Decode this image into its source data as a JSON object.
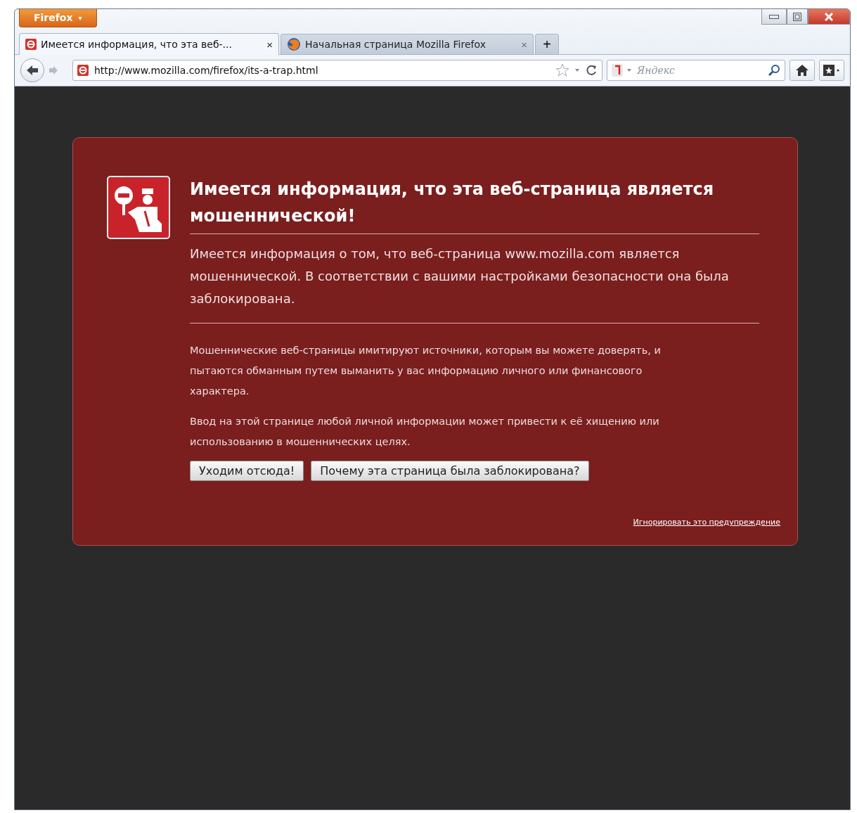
{
  "app_button": {
    "label": "Firefox",
    "caret": "▾"
  },
  "tabs": [
    {
      "label": "Имеется информация, что эта веб-...",
      "close": "×",
      "selected": true,
      "kind": "blocked"
    },
    {
      "label": "Начальная страница Mozilla Firefox",
      "close": "×",
      "selected": false,
      "kind": "firefox"
    }
  ],
  "new_tab": "+",
  "address": {
    "url": "http://www.mozilla.com/firefox/its-a-trap.html"
  },
  "search": {
    "placeholder": "Яндекс"
  },
  "warning": {
    "title": "Имеется информация, что эта веб-страница является мошеннической!",
    "summary": "Имеется информация о том, что веб-страница www.mozilla.com является мошеннической. В соответствии с вашими настройками безопасности она была заблокирована.",
    "paragraphs": [
      "Мошеннические веб-страницы имитируют источники, которым вы можете доверять, и пытаются обманным путем выманить у вас информацию личного или финансового характера.",
      "Ввод на этой странице любой личной информации может привести к её хищению или использованию в мошеннических целях."
    ],
    "buttons": [
      "Уходим отсюда!",
      "Почему эта страница была заблокирована?"
    ],
    "ignore_link": "Игнорировать это предупреждение"
  }
}
